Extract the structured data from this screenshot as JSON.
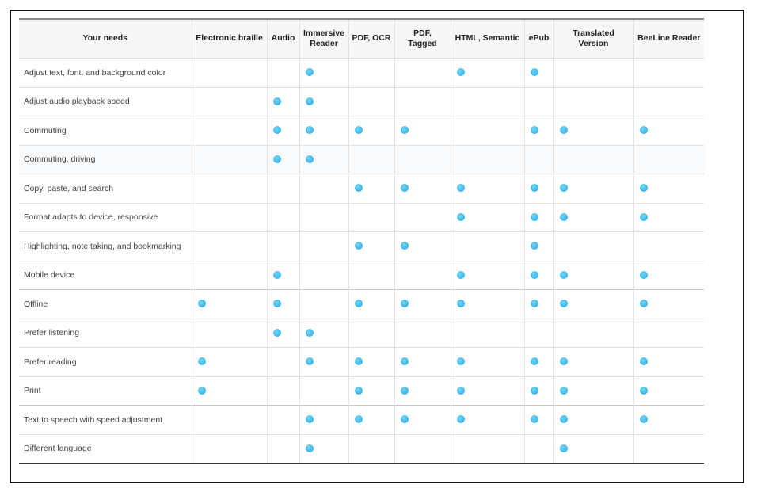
{
  "table": {
    "columns": [
      "Your needs",
      "Electronic braille",
      "Audio",
      "Immersive Reader",
      "PDF, OCR",
      "PDF, Tagged",
      "HTML, Semantic",
      "ePub",
      "Translated Version",
      "BeeLine Reader"
    ],
    "indicator": {
      "name": "supported-dot-icon",
      "color": "#3db4e8"
    },
    "rows": [
      {
        "need": "Adjust text, font, and background color",
        "supported": [
          false,
          false,
          true,
          false,
          false,
          true,
          true,
          false,
          false
        ]
      },
      {
        "need": "Adjust audio playback speed",
        "supported": [
          false,
          true,
          true,
          false,
          false,
          false,
          false,
          false,
          false
        ]
      },
      {
        "need": "Commuting",
        "supported": [
          false,
          true,
          true,
          true,
          true,
          false,
          true,
          true,
          true
        ]
      },
      {
        "need": "Commuting, driving",
        "supported": [
          false,
          true,
          true,
          false,
          false,
          false,
          false,
          false,
          false
        ]
      },
      {
        "need": "Copy, paste, and search",
        "supported": [
          false,
          false,
          false,
          true,
          true,
          true,
          true,
          true,
          true
        ]
      },
      {
        "need": "Format adapts to device, responsive",
        "supported": [
          false,
          false,
          false,
          false,
          false,
          true,
          true,
          true,
          true
        ]
      },
      {
        "need": "Highlighting, note taking, and bookmarking",
        "supported": [
          false,
          false,
          false,
          true,
          true,
          false,
          true,
          false,
          false
        ]
      },
      {
        "need": "Mobile device",
        "supported": [
          false,
          true,
          false,
          false,
          false,
          true,
          true,
          true,
          true
        ]
      },
      {
        "need": "Offline",
        "supported": [
          true,
          true,
          false,
          true,
          true,
          true,
          true,
          true,
          true
        ]
      },
      {
        "need": "Prefer listening",
        "supported": [
          false,
          true,
          true,
          false,
          false,
          false,
          false,
          false,
          false
        ]
      },
      {
        "need": "Prefer reading",
        "supported": [
          true,
          false,
          true,
          true,
          true,
          true,
          true,
          true,
          true
        ]
      },
      {
        "need": "Print",
        "supported": [
          true,
          false,
          false,
          true,
          true,
          true,
          true,
          true,
          true
        ]
      },
      {
        "need": "Text to speech with speed adjustment",
        "supported": [
          false,
          false,
          true,
          true,
          true,
          true,
          true,
          true,
          true
        ]
      },
      {
        "need": "Different language",
        "supported": [
          false,
          false,
          true,
          false,
          false,
          false,
          false,
          true,
          false
        ]
      }
    ]
  }
}
